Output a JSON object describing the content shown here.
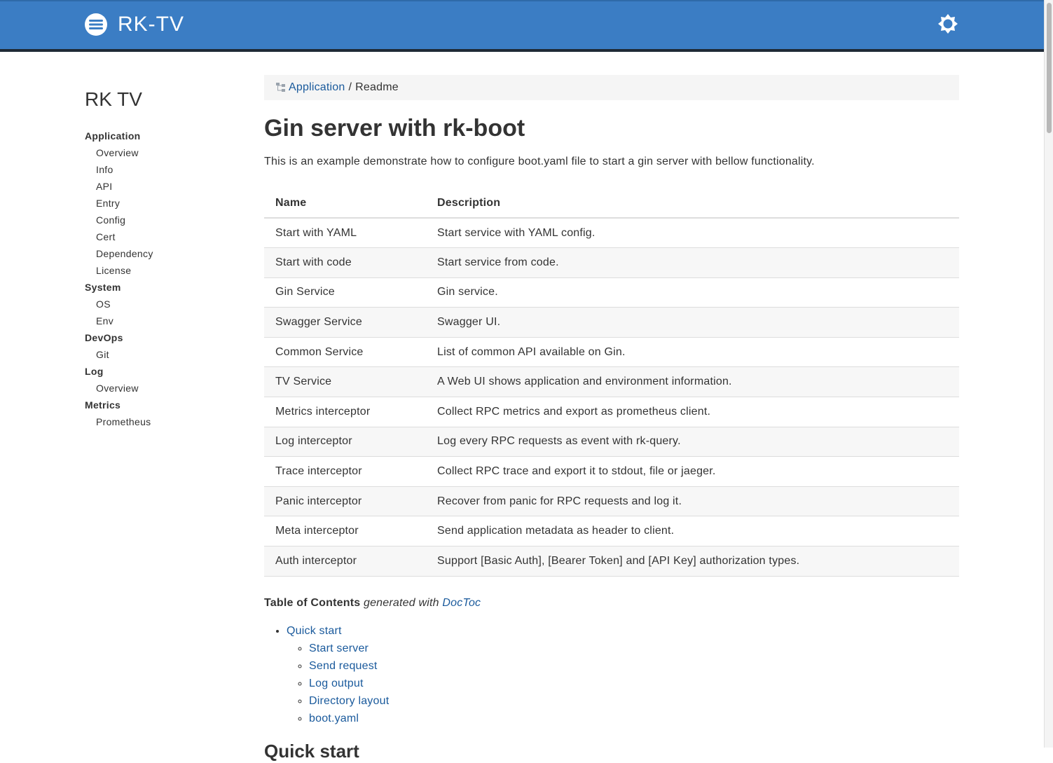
{
  "header": {
    "brand": "RK-TV",
    "logo_icon": "menu-circle-icon",
    "theme_icon": "sun-icon",
    "background": "#3b7dc4"
  },
  "sidebar": {
    "title": "RK TV",
    "sections": [
      {
        "label": "Application",
        "items": [
          "Overview",
          "Info",
          "API",
          "Entry",
          "Config",
          "Cert",
          "Dependency",
          "License"
        ]
      },
      {
        "label": "System",
        "items": [
          "OS",
          "Env"
        ]
      },
      {
        "label": "DevOps",
        "items": [
          "Git"
        ]
      },
      {
        "label": "Log",
        "items": [
          "Overview"
        ]
      },
      {
        "label": "Metrics",
        "items": [
          "Prometheus"
        ]
      }
    ]
  },
  "breadcrumb": {
    "icon": "sitemap-icon",
    "link": "Application",
    "separator": "/",
    "current": "Readme"
  },
  "main": {
    "title": "Gin server with rk-boot",
    "intro": "This is an example demonstrate how to configure boot.yaml file to start a gin server with bellow functionality.",
    "table": {
      "headers": [
        "Name",
        "Description"
      ],
      "rows": [
        [
          "Start with YAML",
          "Start service with YAML config."
        ],
        [
          "Start with code",
          "Start service from code."
        ],
        [
          "Gin Service",
          "Gin service."
        ],
        [
          "Swagger Service",
          "Swagger UI."
        ],
        [
          "Common Service",
          "List of common API available on Gin."
        ],
        [
          "TV Service",
          "A Web UI shows application and environment information."
        ],
        [
          "Metrics interceptor",
          "Collect RPC metrics and export as prometheus client."
        ],
        [
          "Log interceptor",
          "Log every RPC requests as event with rk-query."
        ],
        [
          "Trace interceptor",
          "Collect RPC trace and export it to stdout, file or jaeger."
        ],
        [
          "Panic interceptor",
          "Recover from panic for RPC requests and log it."
        ],
        [
          "Meta interceptor",
          "Send application metadata as header to client."
        ],
        [
          "Auth interceptor",
          "Support [Basic Auth], [Bearer Token] and [API Key] authorization types."
        ]
      ]
    },
    "toc": {
      "bold": "Table of Contents",
      "italic": "generated with",
      "link": "DocToc",
      "items": [
        {
          "label": "Quick start",
          "children": [
            "Start server",
            "Send request",
            "Log output",
            "Directory layout",
            "boot.yaml"
          ]
        }
      ]
    },
    "section_title": "Quick start"
  }
}
